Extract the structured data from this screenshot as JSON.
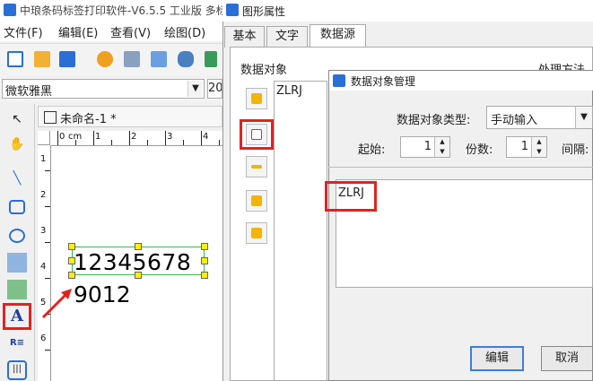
{
  "app": {
    "title": "中琅条码标签打印软件-V6.5.5 工业版 多标",
    "menu": [
      "文件(F)",
      "编辑(E)",
      "查看(V)",
      "绘图(D)"
    ],
    "font_name": "微软雅黑",
    "font_size": "20",
    "doc_tab": "未命名-1 *",
    "ruler_top": [
      "0",
      "cm",
      "1",
      "2",
      "3",
      "4"
    ],
    "ruler_left": [
      "1",
      "2",
      "3",
      "4",
      "5",
      "6"
    ],
    "label_text_line1": "12345678",
    "label_text_line2": "9012"
  },
  "properties": {
    "title": "图形属性",
    "tabs": [
      "基本",
      "文字",
      "数据源"
    ],
    "active_tab": "数据源",
    "group_label": "数据对象",
    "cut_label": "处理方法",
    "objects": [
      "ZLRJ"
    ]
  },
  "data_object_dialog": {
    "title": "数据对象管理",
    "type_label": "数据对象类型:",
    "type_value": "手动输入",
    "start_label": "起始:",
    "start_value": "1",
    "copies_label": "份数:",
    "copies_value": "1",
    "interval_label": "间隔:",
    "data_value": "ZLRJ",
    "edit_button": "编辑",
    "cancel_button": "取消"
  },
  "colors": {
    "highlight": "#e3221f",
    "selection": "#39b54a",
    "handle": "#ffee00"
  }
}
